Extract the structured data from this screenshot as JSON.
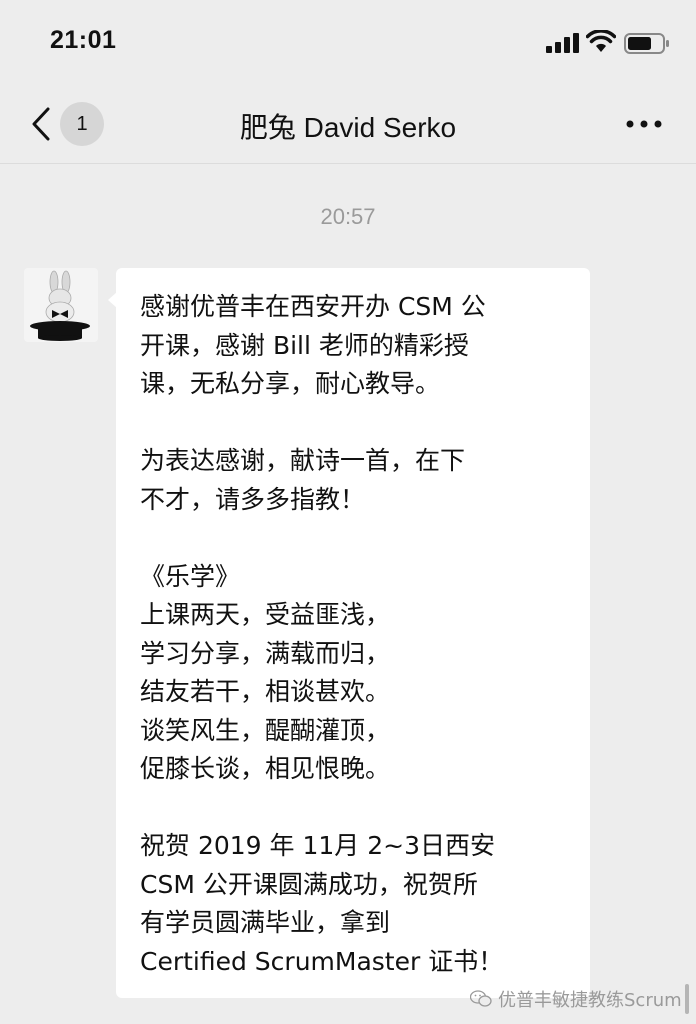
{
  "status_bar": {
    "time": "21:01",
    "icons": [
      "cellular-signal-icon",
      "wifi-icon",
      "battery-icon"
    ]
  },
  "nav": {
    "back_icon": "chevron-left-icon",
    "unread_count": "1",
    "title": "肥兔 David Serko",
    "more_icon": "more-dots-icon"
  },
  "chat": {
    "timestamp": "20:57",
    "sender_avatar": "rabbit-in-top-hat-avatar",
    "message_lines": [
      "感谢优普丰在西安开办 CSM 公",
      "开课，感谢 Bill 老师的精彩授",
      "课，无私分享，耐心教导。",
      "",
      "为表达感谢，献诗一首，在下",
      "不才，请多多指教！",
      "",
      "《乐学》",
      "上课两天，受益匪浅，",
      "学习分享，满载而归，",
      "结友若干，相谈甚欢。",
      "谈笑风生，醍醐灌顶，",
      "促膝长谈，相见恨晚。",
      "",
      "祝贺 2019 年 11月 2~3日西安",
      "CSM 公开课圆满成功，祝贺所",
      "有学员圆满毕业，拿到",
      "Certified ScrumMaster 证书！"
    ]
  },
  "watermark": {
    "icon": "wechat-icon",
    "text": "优普丰敏捷教练Scrum"
  },
  "colors": {
    "background": "#ededed",
    "bubble": "#ffffff",
    "timestamp": "#9a9a9a"
  }
}
